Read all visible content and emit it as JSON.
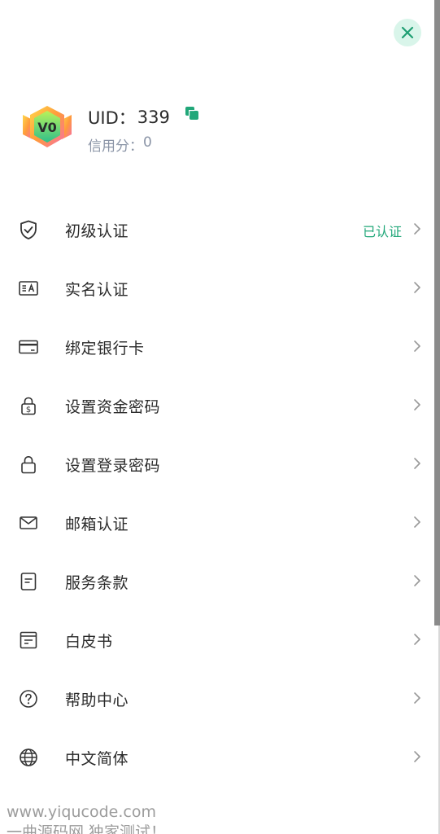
{
  "header": {
    "close_icon": "close-icon",
    "accent_color": "#21a779"
  },
  "profile": {
    "level_badge": "V0",
    "uid_label": "UID：",
    "uid_value": "339",
    "credit_label": "信用分：",
    "credit_value": "0"
  },
  "menu": {
    "items": [
      {
        "label": "初级认证",
        "status": "已认证",
        "icon": "shield-check-icon"
      },
      {
        "label": "实名认证",
        "status": "",
        "icon": "id-card-icon"
      },
      {
        "label": "绑定银行卡",
        "status": "",
        "icon": "bank-card-icon"
      },
      {
        "label": "设置资金密码",
        "status": "",
        "icon": "dollar-lock-icon"
      },
      {
        "label": "设置登录密码",
        "status": "",
        "icon": "lock-icon"
      },
      {
        "label": "邮箱认证",
        "status": "",
        "icon": "mail-icon"
      },
      {
        "label": "服务条款",
        "status": "",
        "icon": "document-icon"
      },
      {
        "label": "白皮书",
        "status": "",
        "icon": "whitepaper-icon"
      },
      {
        "label": "帮助中心",
        "status": "",
        "icon": "help-circle-icon"
      },
      {
        "label": "中文简体",
        "status": "",
        "icon": "globe-icon"
      }
    ]
  },
  "watermark": {
    "line1": "www.yiqucode.com",
    "line2": "一曲源码网 独家测试！"
  }
}
